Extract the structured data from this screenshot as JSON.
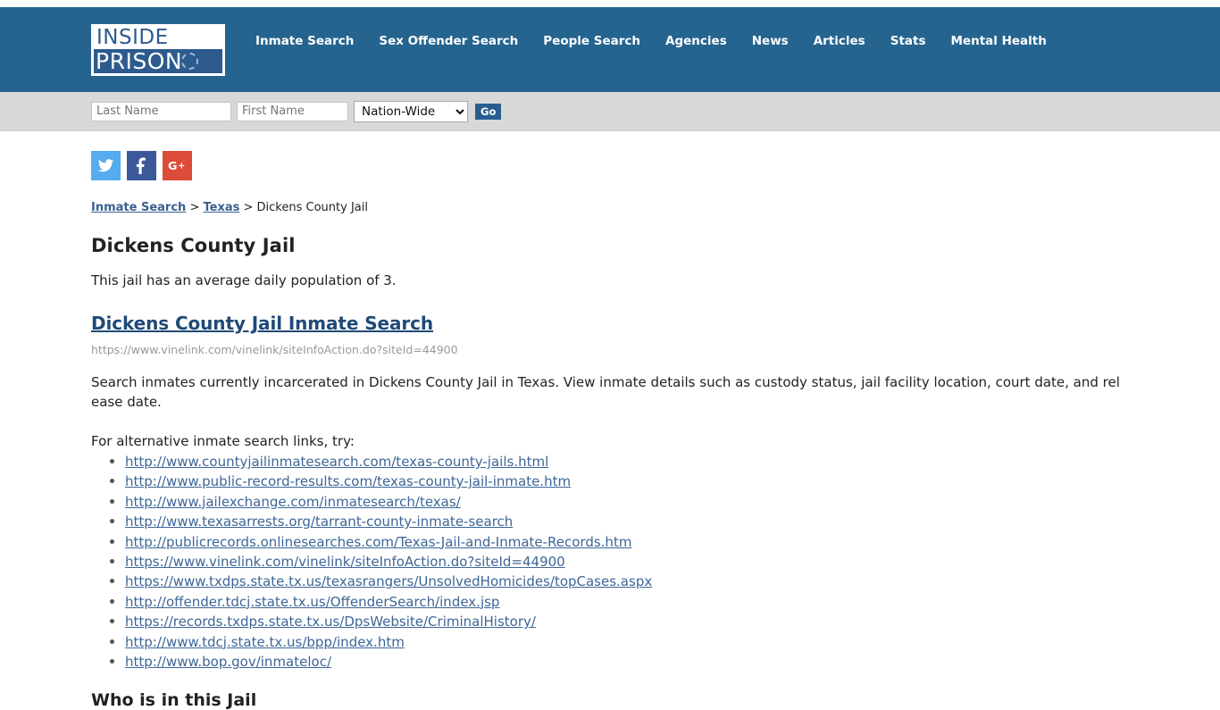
{
  "header": {
    "logo": {
      "line1": "INSIDE",
      "line2": "PRISON",
      "ring_icon": "barbed-wire-circle-icon"
    },
    "nav": [
      {
        "label": "Inmate Search"
      },
      {
        "label": "Sex Offender Search"
      },
      {
        "label": "People Search"
      },
      {
        "label": "Agencies"
      },
      {
        "label": "News"
      },
      {
        "label": "Articles"
      },
      {
        "label": "Stats"
      },
      {
        "label": "Mental Health"
      }
    ],
    "brand_color": "#25648f"
  },
  "search": {
    "last_name_value": "",
    "last_name_placeholder": "Last Name",
    "first_name_value": "",
    "first_name_placeholder": "First Name",
    "scope_selected": "Nation-Wide",
    "scope_options": [
      "Nation-Wide"
    ],
    "go_label": "Go",
    "go_color": "#2a5d8f"
  },
  "social": [
    {
      "name": "twitter-icon",
      "label": "Twitter",
      "color": "#55acee"
    },
    {
      "name": "facebook-icon",
      "label": "Facebook",
      "color": "#3b5998"
    },
    {
      "name": "google-plus-icon",
      "label": "Google Plus",
      "color": "#dd4b39"
    }
  ],
  "breadcrumb": {
    "item1": "Inmate Search",
    "sep1": ">",
    "item2": "Texas",
    "sep2": ">",
    "current": "Dickens County Jail"
  },
  "main": {
    "page_title": "Dickens County Jail",
    "intro": "This jail has an average daily population of 3.",
    "result_title": "Dickens County Jail Inmate Search",
    "result_url": "https://www.vinelink.com/vinelink/siteInfoAction.do?siteId=44900",
    "result_desc": "Search inmates currently incarcerated in Dickens County Jail in Texas. View inmate details such as custody status, jail facility location, court date, and release date.",
    "alt_intro": "For alternative inmate search links, try:",
    "alt_links": [
      "http://www.countyjailinmatesearch.com/texas-county-jails.html",
      "http://www.public-record-results.com/texas-county-jail-inmate.htm",
      "http://www.jailexchange.com/inmatesearch/texas/",
      "http://www.texasarrests.org/tarrant-county-inmate-search",
      "http://publicrecords.onlinesearches.com/Texas-Jail-and-Inmate-Records.htm",
      "https://www.vinelink.com/vinelink/siteInfoAction.do?siteId=44900",
      "https://www.txdps.state.tx.us/texasrangers/UnsolvedHomicides/topCases.aspx",
      "http://offender.tdcj.state.tx.us/OffenderSearch/index.jsp",
      "https://records.txdps.state.tx.us/DpsWebsite/CriminalHistory/",
      "http://www.tdcj.state.tx.us/bpp/index.htm",
      "http://www.bop.gov/inmateloc/"
    ],
    "section_title": "Who is in this Jail"
  }
}
